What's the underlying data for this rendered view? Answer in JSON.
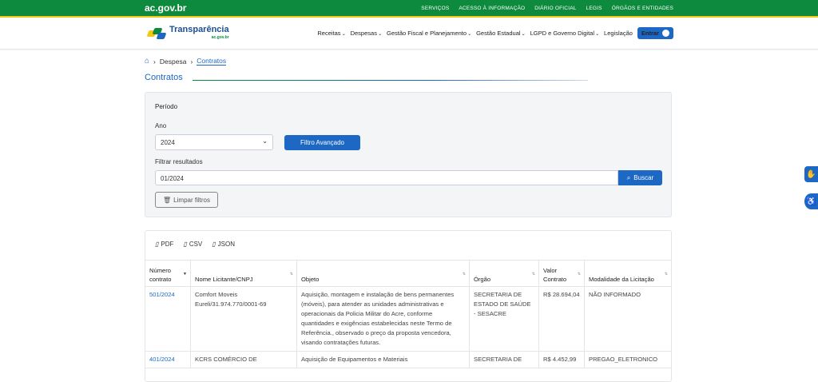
{
  "topbar": {
    "brand": "ac.gov.br",
    "links": [
      "SERVIÇOS",
      "ACESSO À INFORMAÇÃO",
      "DIÁRIO OFICIAL",
      "LEGIS",
      "ÓRGÃOS E ENTIDADES"
    ]
  },
  "navbar": {
    "logo_text": "Transparência",
    "logo_sub": "ac.gov.br",
    "menu": [
      {
        "label": "Receitas",
        "dropdown": true
      },
      {
        "label": "Despesas",
        "dropdown": true
      },
      {
        "label": "Gestão Fiscal e Planejamento",
        "dropdown": true
      },
      {
        "label": "Gestão Estadual",
        "dropdown": true
      },
      {
        "label": "LGPD e Governo Digital",
        "dropdown": true
      },
      {
        "label": "Legislação",
        "dropdown": false
      }
    ],
    "login_label": "Entrar"
  },
  "breadcrumb": {
    "items": [
      "Despesa",
      "Contratos"
    ]
  },
  "page_title": "Contratos",
  "filter": {
    "section_label": "Período",
    "year_label": "Ano",
    "year_value": "2024",
    "advanced_button": "Filtro Avançado",
    "filter_label": "Filtrar resultados",
    "filter_value": "01/2024",
    "search_button": "Buscar",
    "clear_button": "Limpar filtros"
  },
  "exports": [
    "PDF",
    "CSV",
    "JSON"
  ],
  "table": {
    "columns": [
      "Número contrato",
      "Nome Licitante/CNPJ",
      "Objeto",
      "Órgão",
      "Valor Contrato",
      "Modalidade da Licitação"
    ],
    "rows": [
      {
        "numero": "501/2024",
        "licitante": "Comfort Moveis Eureli/31.974.770/0001-69",
        "objeto": "Aquisição, montagem e instalação de bens permanentes (móveis), para atender as unidades administrativas e operacionais da Policia Militar do Acre, conforme quantidades e exigências estabelecidas neste Termo de Referência., observado o preço da proposta vencedora, visando contratações futuras.",
        "orgao": "SECRETARIA DE ESTADO DE SAÚDE - SESACRE",
        "valor": "R$ 28.694,04",
        "modalidade": "NÃO INFORMADO"
      },
      {
        "numero": "401/2024",
        "licitante": "KCRS COMÉRCIO DE",
        "objeto": "Aquisição de Equipamentos e Materiais",
        "orgao": "SECRETARIA DE",
        "valor": "R$ 4.452,99",
        "modalidade": "PREGAO_ELETRONICO"
      }
    ]
  }
}
